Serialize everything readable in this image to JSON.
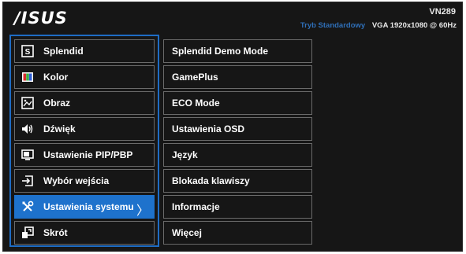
{
  "header": {
    "logo": "/ISUS",
    "model": "VN289",
    "mode": "Tryb Standardowy",
    "signal": "VGA  1920x1080 @ 60Hz"
  },
  "menu": [
    {
      "label": "Splendid",
      "icon": "splendid-icon"
    },
    {
      "label": "Kolor",
      "icon": "color-icon"
    },
    {
      "label": "Obraz",
      "icon": "image-icon"
    },
    {
      "label": "Dźwięk",
      "icon": "speaker-icon"
    },
    {
      "label": "Ustawienie PIP/PBP",
      "icon": "pip-icon"
    },
    {
      "label": "Wybór wejścia",
      "icon": "input-select-icon"
    },
    {
      "label": "Ustawienia systemu",
      "icon": "system-tools-icon",
      "selected": true
    },
    {
      "label": "Skrót",
      "icon": "shortcut-icon"
    }
  ],
  "submenu": [
    "Splendid Demo Mode",
    "GamePlus",
    "ECO Mode",
    "Ustawienia OSD",
    "Język",
    "Blokada klawiszy",
    "Informacje",
    "Więcej"
  ],
  "colors": {
    "background": "#161616",
    "accent": "#1e72cc",
    "border": "#6a6a6a",
    "mode_text": "#2f6fb8"
  }
}
